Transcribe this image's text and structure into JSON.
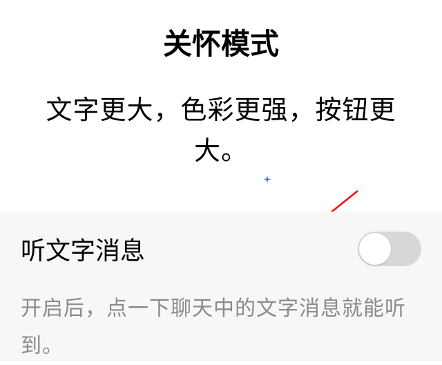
{
  "header": {
    "title": "关怀模式"
  },
  "subtitle": {
    "text": "文字更大，色彩更强，按钮更大。"
  },
  "section": {
    "title": "听文字消息",
    "description": "开启后，点一下聊天中的文字消息就能听到。",
    "toggle": {
      "enabled": false
    }
  }
}
